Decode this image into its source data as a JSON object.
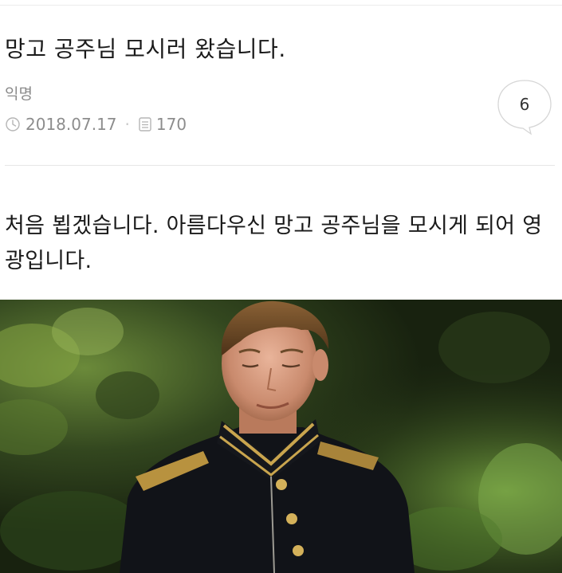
{
  "post": {
    "title": "망고 공주님 모시러 왔습니다.",
    "author": "익명",
    "date": "2018.07.17",
    "views": "170",
    "comment_count": "6",
    "body": "처음 뵙겠습니다. 아름다우신 망고 공주님을 모시게 되어 영광입니다."
  },
  "icons": {
    "date": "clock-icon",
    "views": "document-icon",
    "comments": "speech-bubble-icon"
  },
  "photo": {
    "subject": "young man in dark military uniform with gold epaulettes and buttons"
  },
  "colors": {
    "text": "#1a1a1a",
    "muted": "#8d8d8d",
    "divider": "#e6e6e6",
    "uniform": "#111318",
    "gold": "#c9a54e"
  }
}
